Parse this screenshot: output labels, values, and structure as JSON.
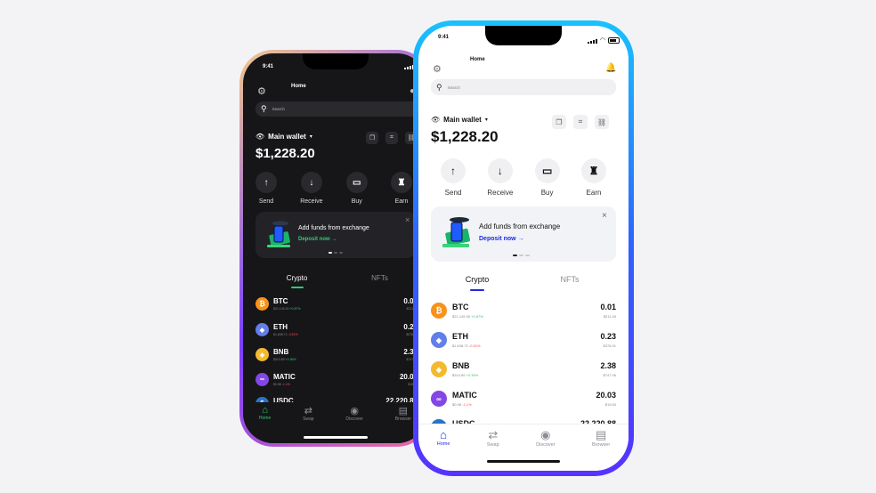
{
  "status": {
    "time": "9:41"
  },
  "header": {
    "title": "Home",
    "settings_icon": "gear-icon",
    "notification_icon": "bell-icon"
  },
  "search": {
    "placeholder": "Search"
  },
  "wallet": {
    "name": "Main wallet",
    "balance": "$1,228.20"
  },
  "actions": [
    {
      "label": "Send",
      "icon": "↑"
    },
    {
      "label": "Receive",
      "icon": "↓"
    },
    {
      "label": "Buy",
      "icon": "▭"
    },
    {
      "label": "Earn",
      "icon": "♜"
    }
  ],
  "banner": {
    "title": "Add funds from exchange",
    "link": "Deposit now",
    "arrow": "→",
    "close": "×"
  },
  "tabs": [
    {
      "label": "Crypto"
    },
    {
      "label": "NFTs"
    }
  ],
  "assets": [
    {
      "symbol": "BTC",
      "sub_price": "$21,149.30",
      "sub_change": "+0.87%",
      "change_dir": "up",
      "amount": "0.01",
      "usd": "$211.49",
      "color": "#f7931a",
      "glyph": "₿"
    },
    {
      "symbol": "ETH",
      "sub_price": "$1,638.72",
      "sub_change": "-0.51%",
      "change_dir": "down",
      "amount": "0.23",
      "usd": "$376.91",
      "color": "#627eea",
      "glyph": "◆"
    },
    {
      "symbol": "BNB",
      "sub_price": "$313.89",
      "sub_change": "+0.36%",
      "change_dir": "up",
      "amount": "2.38",
      "usd": "$747.06",
      "color": "#f3ba2f",
      "glyph": "◈"
    },
    {
      "symbol": "MATIC",
      "sub_price": "$0.98",
      "sub_change": "-1.1%",
      "change_dir": "down",
      "amount": "20.03",
      "usd": "$19.63",
      "color": "#8247e5",
      "glyph": "∞"
    },
    {
      "symbol": "USDC",
      "sub_price": "",
      "sub_change": "",
      "change_dir": "up",
      "amount": "22,220.88",
      "usd": "",
      "color": "#2775ca",
      "glyph": "$"
    }
  ],
  "nav": [
    {
      "label": "Home",
      "icon": "⌂"
    },
    {
      "label": "Swap",
      "icon": "⇄"
    },
    {
      "label": "Discover",
      "icon": "◉"
    },
    {
      "label": "Browser",
      "icon": "▤"
    }
  ],
  "colors": {
    "accent_blue": "#1e2be0",
    "accent_green": "#2ecc71",
    "dark_bg": "#161618",
    "light_bg": "#ffffff"
  }
}
